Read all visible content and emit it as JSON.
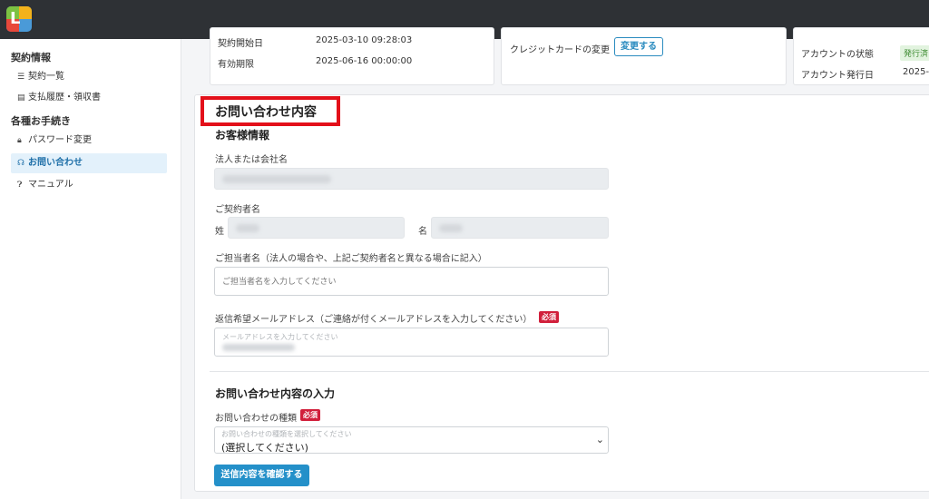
{
  "sidebar": {
    "section1": "契約情報",
    "items1": [
      "契約一覧",
      "支払履歴・領収書"
    ],
    "section2": "各種お手続き",
    "items2": [
      "パスワード変更",
      "お問い合わせ",
      "マニュアル"
    ]
  },
  "contract_card": {
    "row1_label": "契約開始日",
    "row1_value": "2025-03-10 09:28:03",
    "row2_label": "有効期限",
    "row2_value": "2025-06-16 00:00:00"
  },
  "payment_card": {
    "label": "クレジットカードの変更",
    "button": "変更する"
  },
  "account_card": {
    "status_label": "アカウントの状態",
    "status_badge": "発行済",
    "issued_label": "アカウント発行日",
    "issued_value": "2025-0"
  },
  "form": {
    "title": "お問い合わせ内容",
    "customer_section": "お客様情報",
    "company_label": "法人または会社名",
    "contractor_label": "ご契約者名",
    "last_name_label": "姓",
    "first_name_label": "名",
    "person_label": "ご担当者名（法人の場合や、上記ご契約者名と異なる場合に記入）",
    "person_placeholder": "ご担当者名を入力してください",
    "email_label": "返信希望メールアドレス（ご連絡が付くメールアドレスを入力してください）",
    "email_placeholder": "メールアドレスを入力してください",
    "required": "必須",
    "inquiry_section": "お問い合わせ内容の入力",
    "type_label": "お問い合わせの種類",
    "type_placeholder": "お問い合わせの種類を選択してください",
    "type_value": "(選択してください)",
    "submit": "送信内容を確認する"
  },
  "colors": {
    "topbar": "#2e3135",
    "accent": "#2490c9",
    "required": "#d11f3b",
    "highlight": "#e3101a"
  }
}
